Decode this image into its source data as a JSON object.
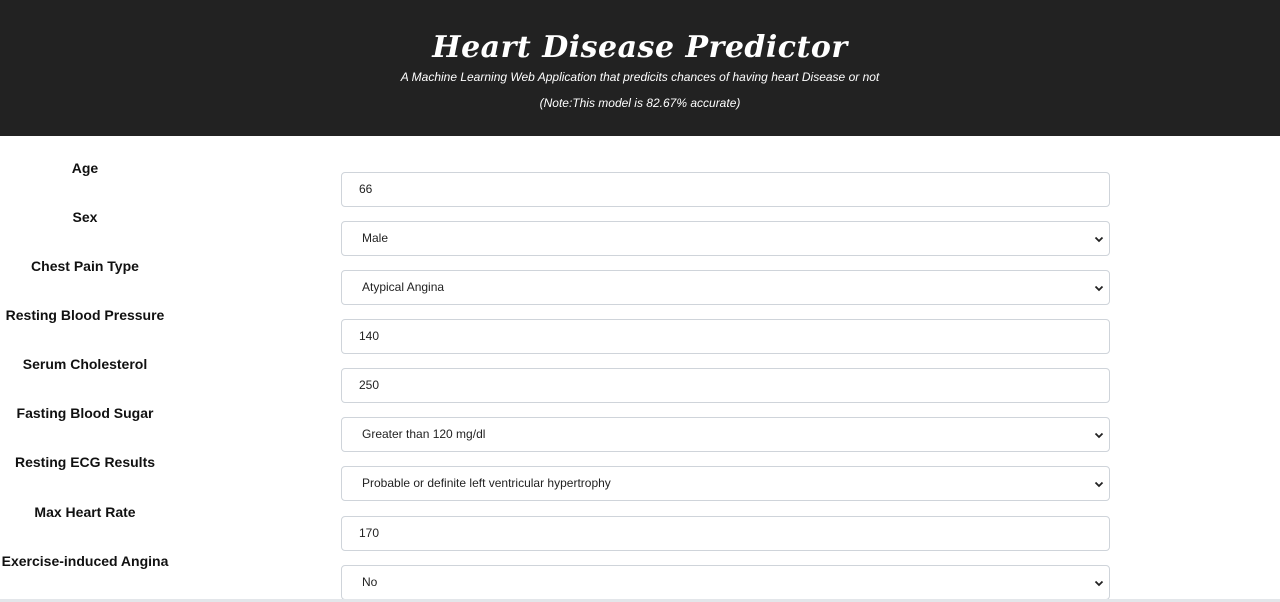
{
  "header": {
    "title": "Heart Disease Predictor",
    "subtitle": "A Machine Learning Web Application that predicits chances of having heart Disease or not",
    "note": "(Note:This model is 82.67% accurate)"
  },
  "form": {
    "fields": [
      {
        "label": "Age",
        "type": "input",
        "value": "66"
      },
      {
        "label": "Sex",
        "type": "select",
        "value": "Male"
      },
      {
        "label": "Chest Pain Type",
        "type": "select",
        "value": "Atypical Angina"
      },
      {
        "label": "Resting Blood Pressure",
        "type": "input",
        "value": "140"
      },
      {
        "label": "Serum Cholesterol",
        "type": "input",
        "value": "250"
      },
      {
        "label": "Fasting Blood Sugar",
        "type": "select",
        "value": "Greater than 120 mg/dl"
      },
      {
        "label": "Resting ECG Results",
        "type": "select",
        "value": "Probable or definite left ventricular hypertrophy"
      },
      {
        "label": "Max Heart Rate",
        "type": "input",
        "value": "170"
      },
      {
        "label": "Exercise-induced Angina",
        "type": "select",
        "value": "No"
      }
    ]
  },
  "icons": {
    "select_arrow": "chevron-down-icon"
  },
  "colors": {
    "header_bg": "#222222",
    "header_text": "#ffffff",
    "field_border": "#cfd4da"
  }
}
